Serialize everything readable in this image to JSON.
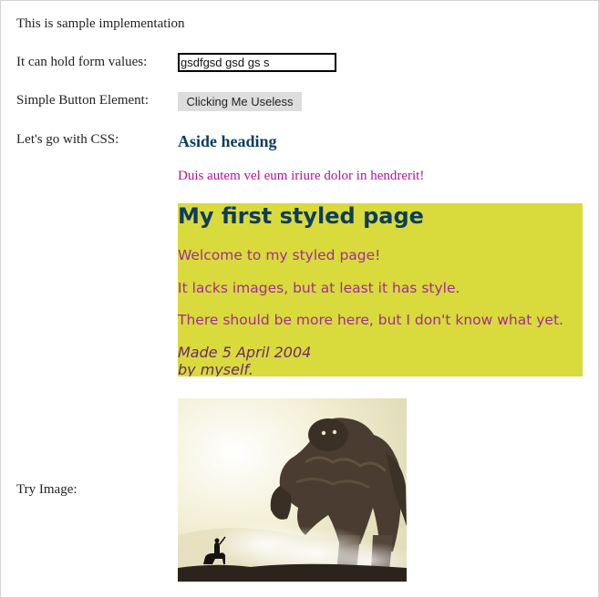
{
  "page": {
    "intro": "This is sample implementation"
  },
  "form": {
    "label": "It can hold form values:",
    "input_value": "gsdfgsd gsd gs s"
  },
  "button_row": {
    "label": "Simple Button Element:",
    "button_label": "Clicking Me Useless"
  },
  "css_row": {
    "label": "Let's go with CSS:",
    "aside_heading": "Aside heading",
    "aside_text": "Duis autem vel eum iriure dolor in hendrerit!",
    "styled": {
      "title": "My first styled page",
      "p1": "Welcome to my styled page!",
      "p2": "It lacks images, but at least it has style.",
      "p3": "There should be more here, but I don't know what yet.",
      "signature_line1": "Made 5 April 2004",
      "signature_line2": "by myself."
    }
  },
  "image_row": {
    "label": "Try Image:"
  },
  "colors": {
    "heading_blue": "#0d3c5e",
    "magenta_text": "#b0169a",
    "styled_bg": "#d9da3c"
  }
}
